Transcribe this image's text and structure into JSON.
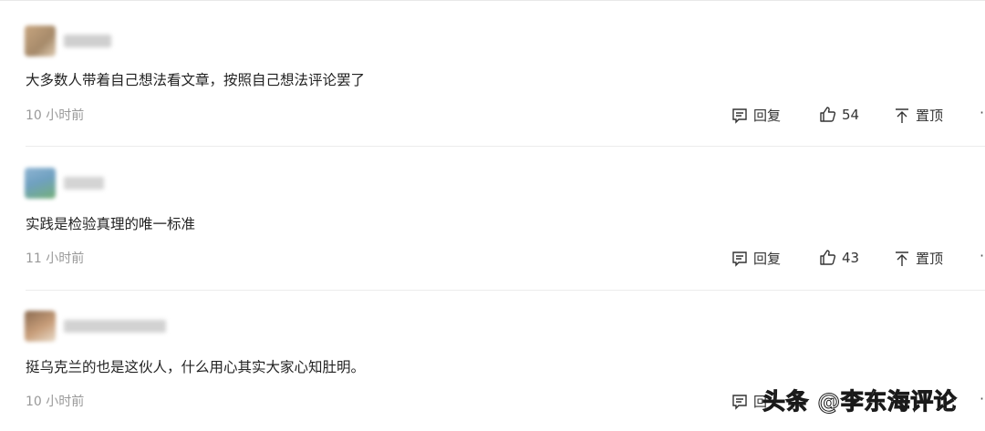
{
  "comments": [
    {
      "text": "大多数人带着自己想法看文章，按照自己想法评论罢了",
      "time": "10 小时前",
      "reply_label": "回复",
      "likes": "54",
      "pin_label": "置顶",
      "avatar_colors": [
        "#c7a57f",
        "#a68a6a"
      ]
    },
    {
      "text": "实践是检验真理的唯一标准",
      "time": "11 小时前",
      "reply_label": "回复",
      "likes": "43",
      "pin_label": "置顶",
      "avatar_colors": [
        "#6fa0c0",
        "#74b079"
      ]
    },
    {
      "text": "挺乌克兰的也是这伙人，什么用心其实大家心知肚明。",
      "time": "10 小时前",
      "reply_label": "回",
      "likes": "",
      "pin_label": "",
      "avatar_colors": [
        "#8a6a50",
        "#c89e7a"
      ]
    }
  ],
  "more_glyph": "·",
  "watermark": "头条 @李东海评论",
  "icons": {
    "reply": "comment-box-icon",
    "like": "thumbs-up-icon",
    "pin": "pin-to-top-icon"
  }
}
